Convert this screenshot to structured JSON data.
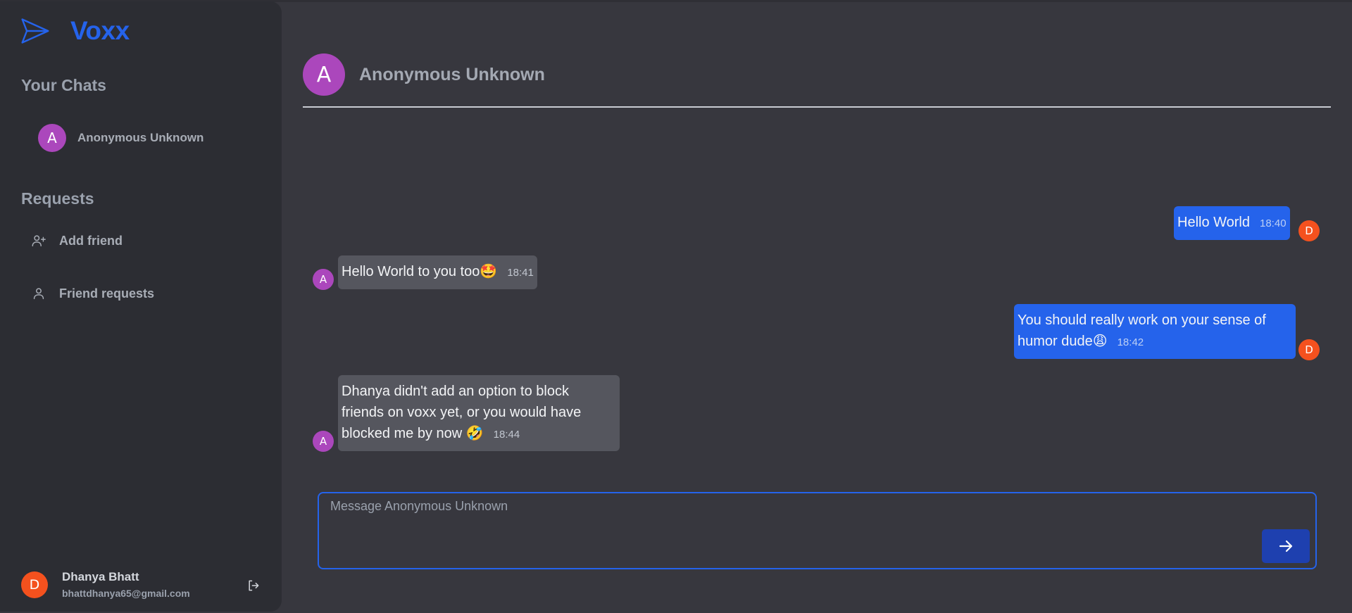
{
  "app": {
    "name": "Voxx",
    "brand_color": "#2563eb"
  },
  "sidebar": {
    "chats_title": "Your Chats",
    "chats": [
      {
        "initial": "A",
        "name": "Anonymous Unknown",
        "avatar_color": "#ab47bc"
      }
    ],
    "requests_title": "Requests",
    "requests": [
      {
        "label": "Add friend",
        "icon": "user-plus-icon"
      },
      {
        "label": "Friend requests",
        "icon": "user-icon"
      }
    ]
  },
  "profile": {
    "initial": "D",
    "name": "Dhanya Bhatt",
    "email": "bhattdhanya65@gmail.com",
    "avatar_color": "#f4511e",
    "logout_icon": "logout-icon"
  },
  "conversation": {
    "initial": "A",
    "title": "Anonymous Unknown"
  },
  "messages": [
    {
      "from": "me",
      "avatar": "D",
      "text": "Hello World",
      "time": "18:40"
    },
    {
      "from": "them",
      "avatar": "A",
      "text": "Hello World to you too🤩",
      "time": "18:41"
    },
    {
      "from": "me",
      "avatar": "D",
      "text_line1": "You should really work on your sense of",
      "text_line2": "humor dude😩",
      "time": "18:42"
    },
    {
      "from": "them",
      "avatar": "A",
      "text_line1": "Dhanya didn't add an option to block",
      "text_line2": "friends on voxx yet, or you would have",
      "text_line3": "blocked me by now 🤣",
      "time": "18:44"
    }
  ],
  "composer": {
    "placeholder": "Message Anonymous Unknown",
    "value": "",
    "send_icon": "arrow-right-icon"
  }
}
